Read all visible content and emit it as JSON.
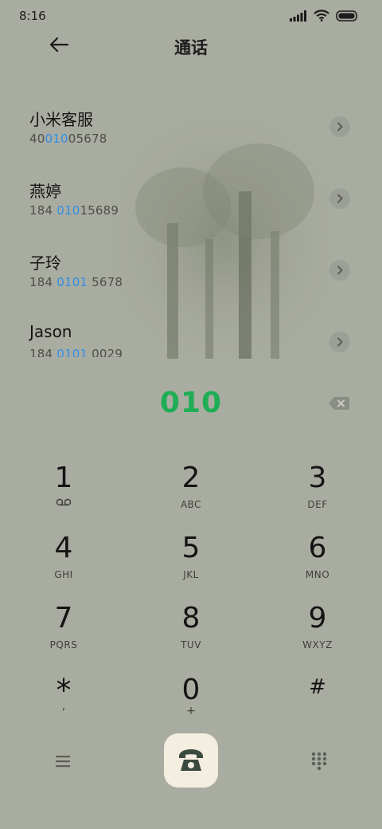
{
  "status_bar": {
    "time": "8:16"
  },
  "header": {
    "title": "通话"
  },
  "contacts": [
    {
      "name": "小米客服",
      "number_parts": [
        "40",
        "010",
        "05678"
      ]
    },
    {
      "name": "燕婷",
      "number_parts": [
        "184 ",
        "010",
        "15689"
      ]
    },
    {
      "name": "子玲",
      "number_parts": [
        "184 ",
        "0101",
        " 5678"
      ]
    },
    {
      "name": "Jason",
      "number_parts": [
        "184 ",
        "0101",
        " 0029"
      ]
    }
  ],
  "dialer": {
    "dialed_number": "010",
    "keys": [
      {
        "digit": "1",
        "sub": "voicemail"
      },
      {
        "digit": "2",
        "sub": "ABC"
      },
      {
        "digit": "3",
        "sub": "DEF"
      },
      {
        "digit": "4",
        "sub": "GHI"
      },
      {
        "digit": "5",
        "sub": "JKL"
      },
      {
        "digit": "6",
        "sub": "MNO"
      },
      {
        "digit": "7",
        "sub": "PQRS"
      },
      {
        "digit": "8",
        "sub": "TUV"
      },
      {
        "digit": "9",
        "sub": "WXYZ"
      },
      {
        "digit": "*",
        "sub": ","
      },
      {
        "digit": "0",
        "sub": "+"
      },
      {
        "digit": "#",
        "sub": ""
      }
    ]
  },
  "colors": {
    "background": "#a9aca1",
    "highlight": "#2f8fe6",
    "dialed": "#1fae55",
    "call_button": "#f3eedf",
    "call_icon": "#3b4a3f"
  },
  "icons": {
    "back": "arrow-left-icon",
    "arrow": "chevron-right-icon",
    "backspace": "backspace-icon",
    "menu": "menu-icon",
    "call": "phone-icon",
    "keypad": "dialpad-icon",
    "voicemail": "voicemail-icon"
  }
}
